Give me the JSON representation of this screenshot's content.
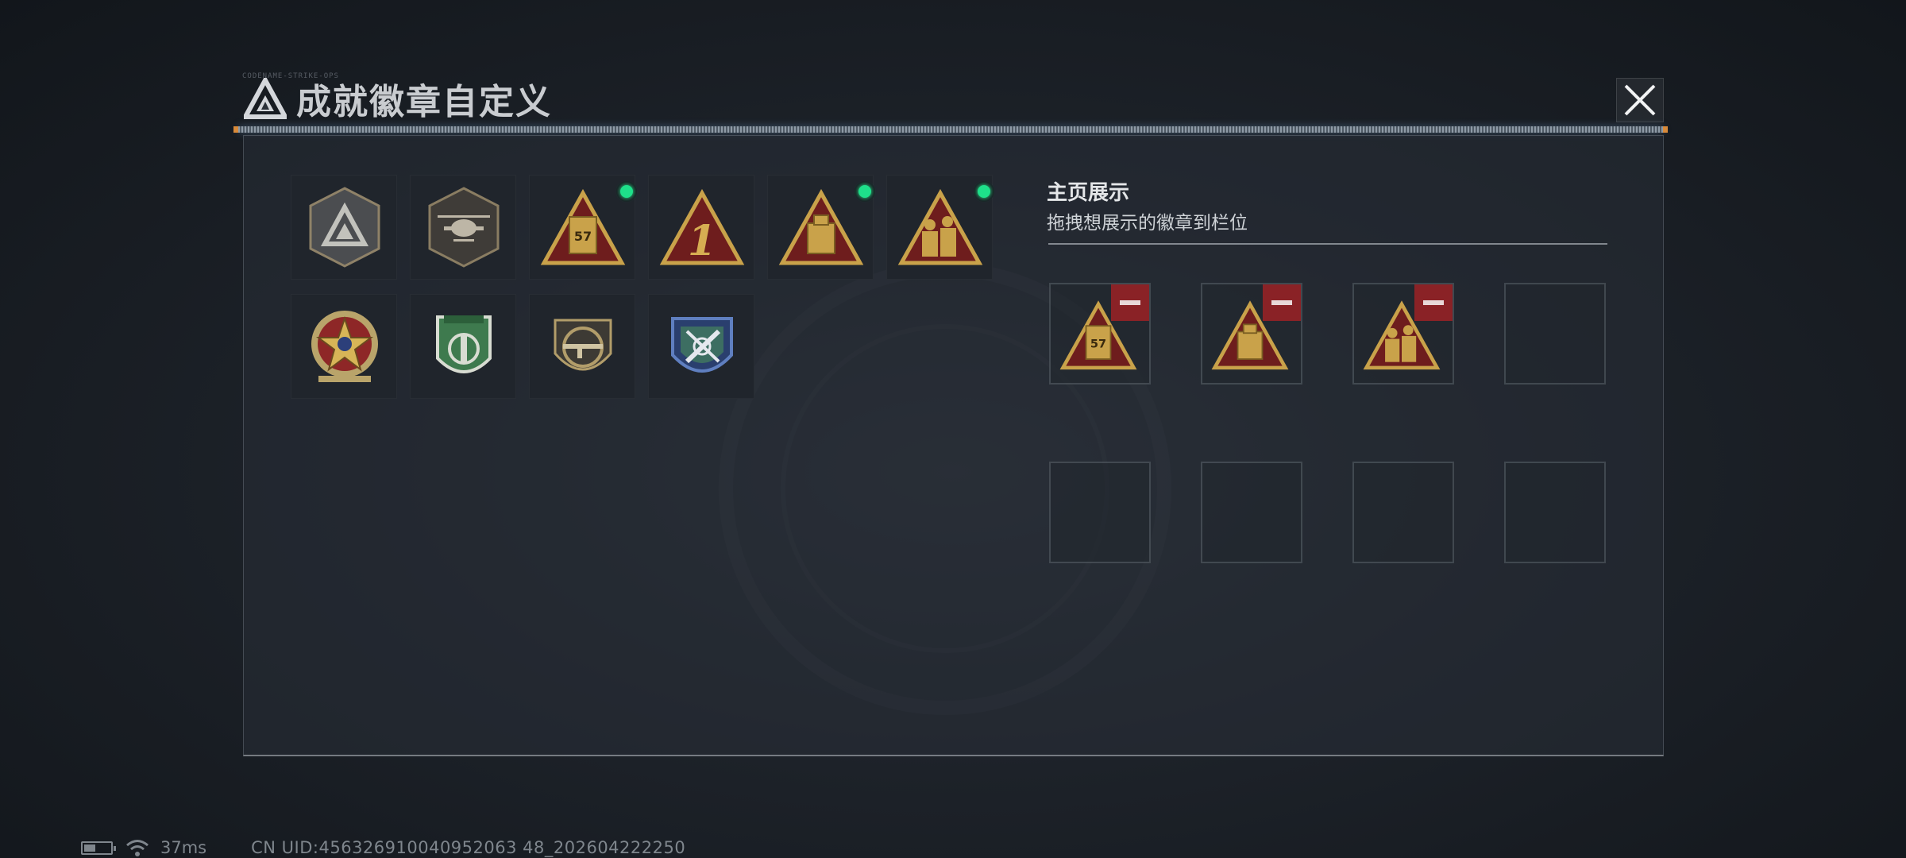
{
  "window": {
    "title": "成就徽章自定义",
    "header_tag": "CODENAME-STRIKE-OPS"
  },
  "badges": [
    {
      "name": "grey-triangle-shield-badge",
      "equipped": false
    },
    {
      "name": "helicopter-shield-badge",
      "equipped": false
    },
    {
      "name": "gold-triangle-57-badge",
      "equipped": true
    },
    {
      "name": "gold-triangle-number-1-badge",
      "equipped": false
    },
    {
      "name": "gold-triangle-box-badge",
      "equipped": true
    },
    {
      "name": "gold-triangle-soldiers-badge",
      "equipped": true
    },
    {
      "name": "star-medal-badge",
      "equipped": false
    },
    {
      "name": "green-wings-shield-badge",
      "equipped": false
    },
    {
      "name": "rifle-circle-badge",
      "equipped": false
    },
    {
      "name": "blue-crossed-arrows-badge",
      "equipped": false
    }
  ],
  "showcase": {
    "title": "主页展示",
    "subtitle": "拖拽想展示的徽章到栏位",
    "slots": [
      {
        "badge": "gold-triangle-57-badge"
      },
      {
        "badge": "gold-triangle-box-badge"
      },
      {
        "badge": "gold-triangle-soldiers-badge"
      },
      {
        "badge": null
      },
      {
        "badge": null
      },
      {
        "badge": null
      },
      {
        "badge": null
      },
      {
        "badge": null
      }
    ]
  },
  "badge_text": {
    "fiftyseven": "57",
    "one": "1"
  },
  "status": {
    "ping": "37ms",
    "uid": "CN UID:456326910040952063 48_202604222250",
    "battery_level": 0.45
  },
  "colors": {
    "equipped": "#1ee08a",
    "remove": "#8a2226",
    "gold": "#c9a24a"
  }
}
